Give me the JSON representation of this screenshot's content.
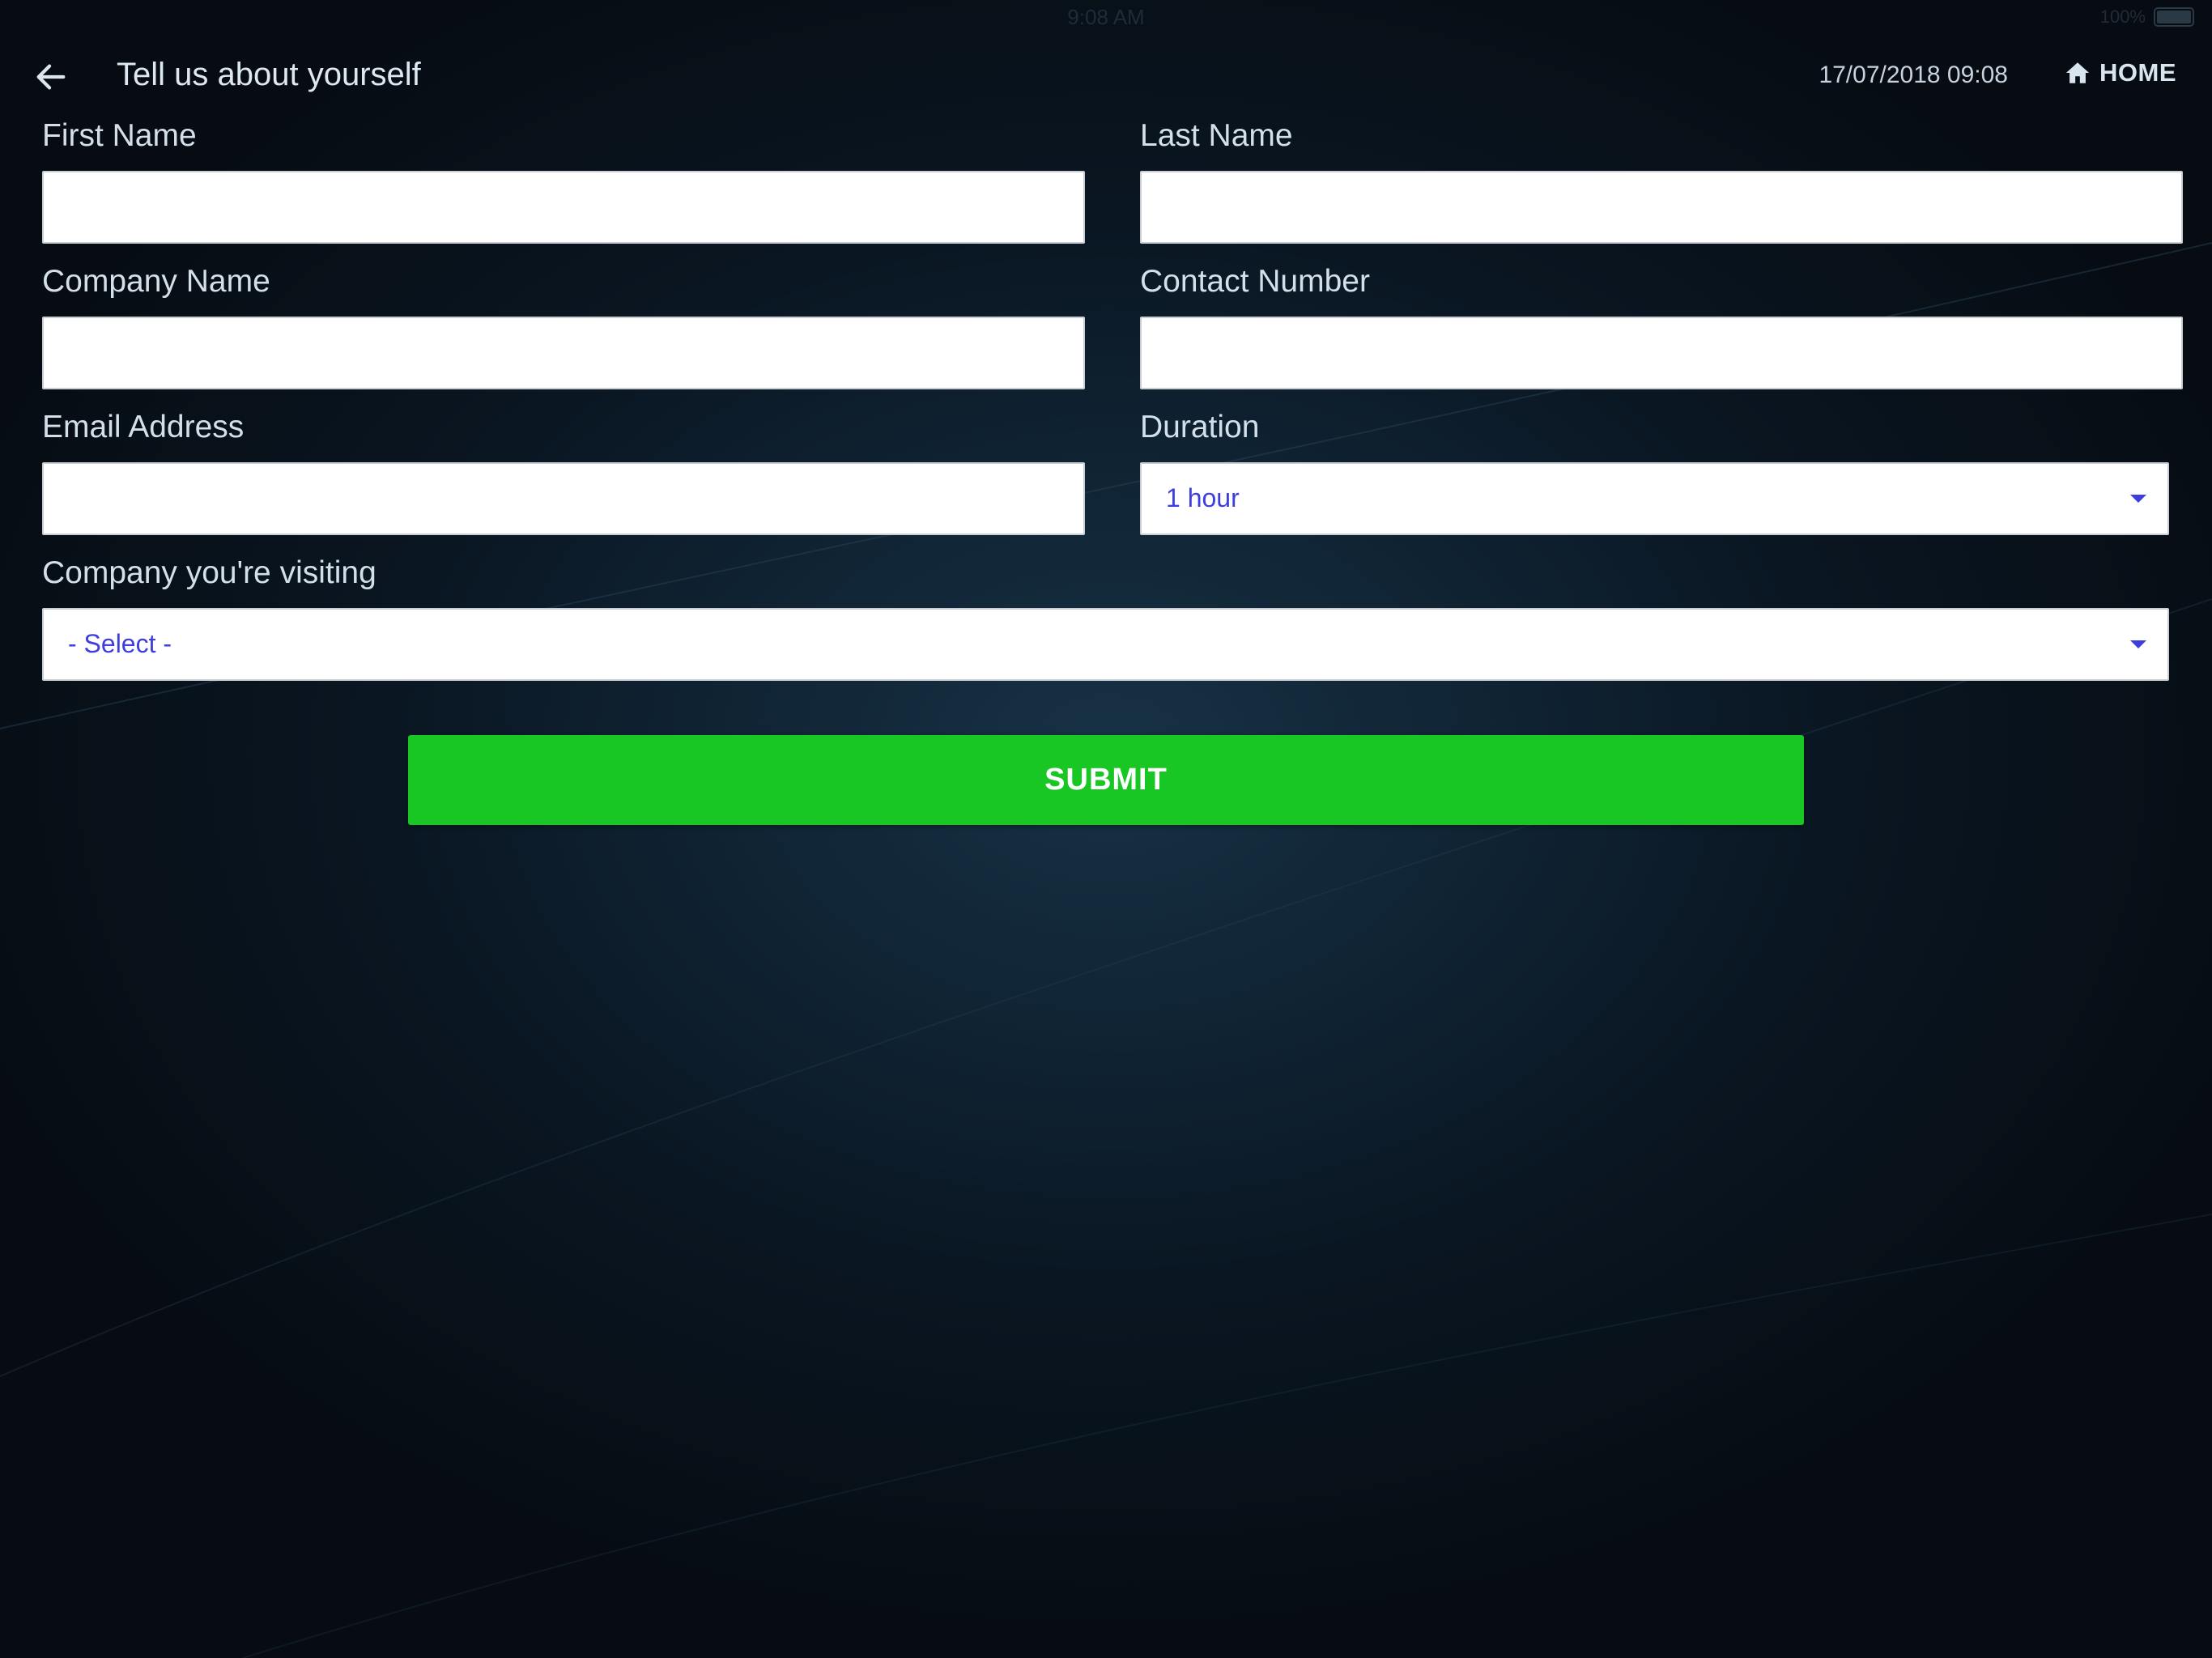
{
  "status_bar": {
    "time": "9:08 AM",
    "battery_text": "100%"
  },
  "header": {
    "back_icon": "arrow-left-icon",
    "title": "Tell us about yourself",
    "datetime": "17/07/2018 09:08",
    "home_icon": "home-icon",
    "home_label": "HOME"
  },
  "form": {
    "first_name": {
      "label": "First Name",
      "value": "",
      "placeholder": ""
    },
    "last_name": {
      "label": "Last Name",
      "value": "",
      "placeholder": ""
    },
    "company_name": {
      "label": "Company Name",
      "value": "",
      "placeholder": ""
    },
    "contact_number": {
      "label": "Contact Number",
      "value": "",
      "placeholder": ""
    },
    "email_address": {
      "label": "Email Address",
      "value": "",
      "placeholder": ""
    },
    "duration": {
      "label": "Duration",
      "selected": "1 hour"
    },
    "company_visiting": {
      "label": "Company you're visiting",
      "selected": "- Select -"
    },
    "submit_label": "SUBMIT"
  },
  "colors": {
    "accent_submit": "#18c723",
    "select_text": "#3d3de0",
    "background": "#0a1622"
  }
}
